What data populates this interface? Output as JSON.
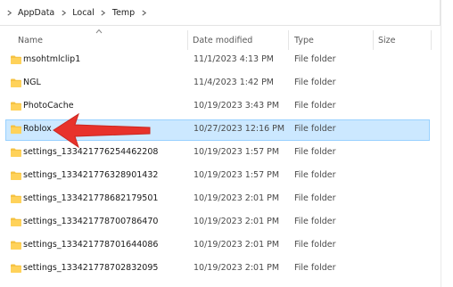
{
  "breadcrumb": {
    "items": [
      "AppData",
      "Local",
      "Temp"
    ]
  },
  "columns": {
    "name": "Name",
    "date": "Date modified",
    "type": "Type",
    "size": "Size"
  },
  "rows": [
    {
      "name": "msohtmlclip1",
      "date": "11/1/2023 4:13 PM",
      "type": "File folder"
    },
    {
      "name": "NGL",
      "date": "11/4/2023 1:42 PM",
      "type": "File folder"
    },
    {
      "name": "PhotoCache",
      "date": "10/19/2023 3:43 PM",
      "type": "File folder"
    },
    {
      "name": "Roblox",
      "date": "10/27/2023 12:16 PM",
      "type": "File folder",
      "selected": true
    },
    {
      "name": "settings_133421776254462208",
      "date": "10/19/2023 1:57 PM",
      "type": "File folder"
    },
    {
      "name": "settings_133421776328901432",
      "date": "10/19/2023 1:57 PM",
      "type": "File folder"
    },
    {
      "name": "settings_133421778682179501",
      "date": "10/19/2023 2:01 PM",
      "type": "File folder"
    },
    {
      "name": "settings_133421778700786470",
      "date": "10/19/2023 2:01 PM",
      "type": "File folder"
    },
    {
      "name": "settings_133421778701644086",
      "date": "10/19/2023 2:01 PM",
      "type": "File folder"
    },
    {
      "name": "settings_133421778702832095",
      "date": "10/19/2023 2:01 PM",
      "type": "File folder"
    }
  ],
  "colors": {
    "selection": "#cce8ff",
    "selection_border": "#99d1ff",
    "folder": "#f5c242",
    "arrow": "#e8322b"
  },
  "icons": {
    "folder": "folder-icon",
    "chevron": "chevron-right-icon",
    "annotation": "red-arrow-icon"
  }
}
